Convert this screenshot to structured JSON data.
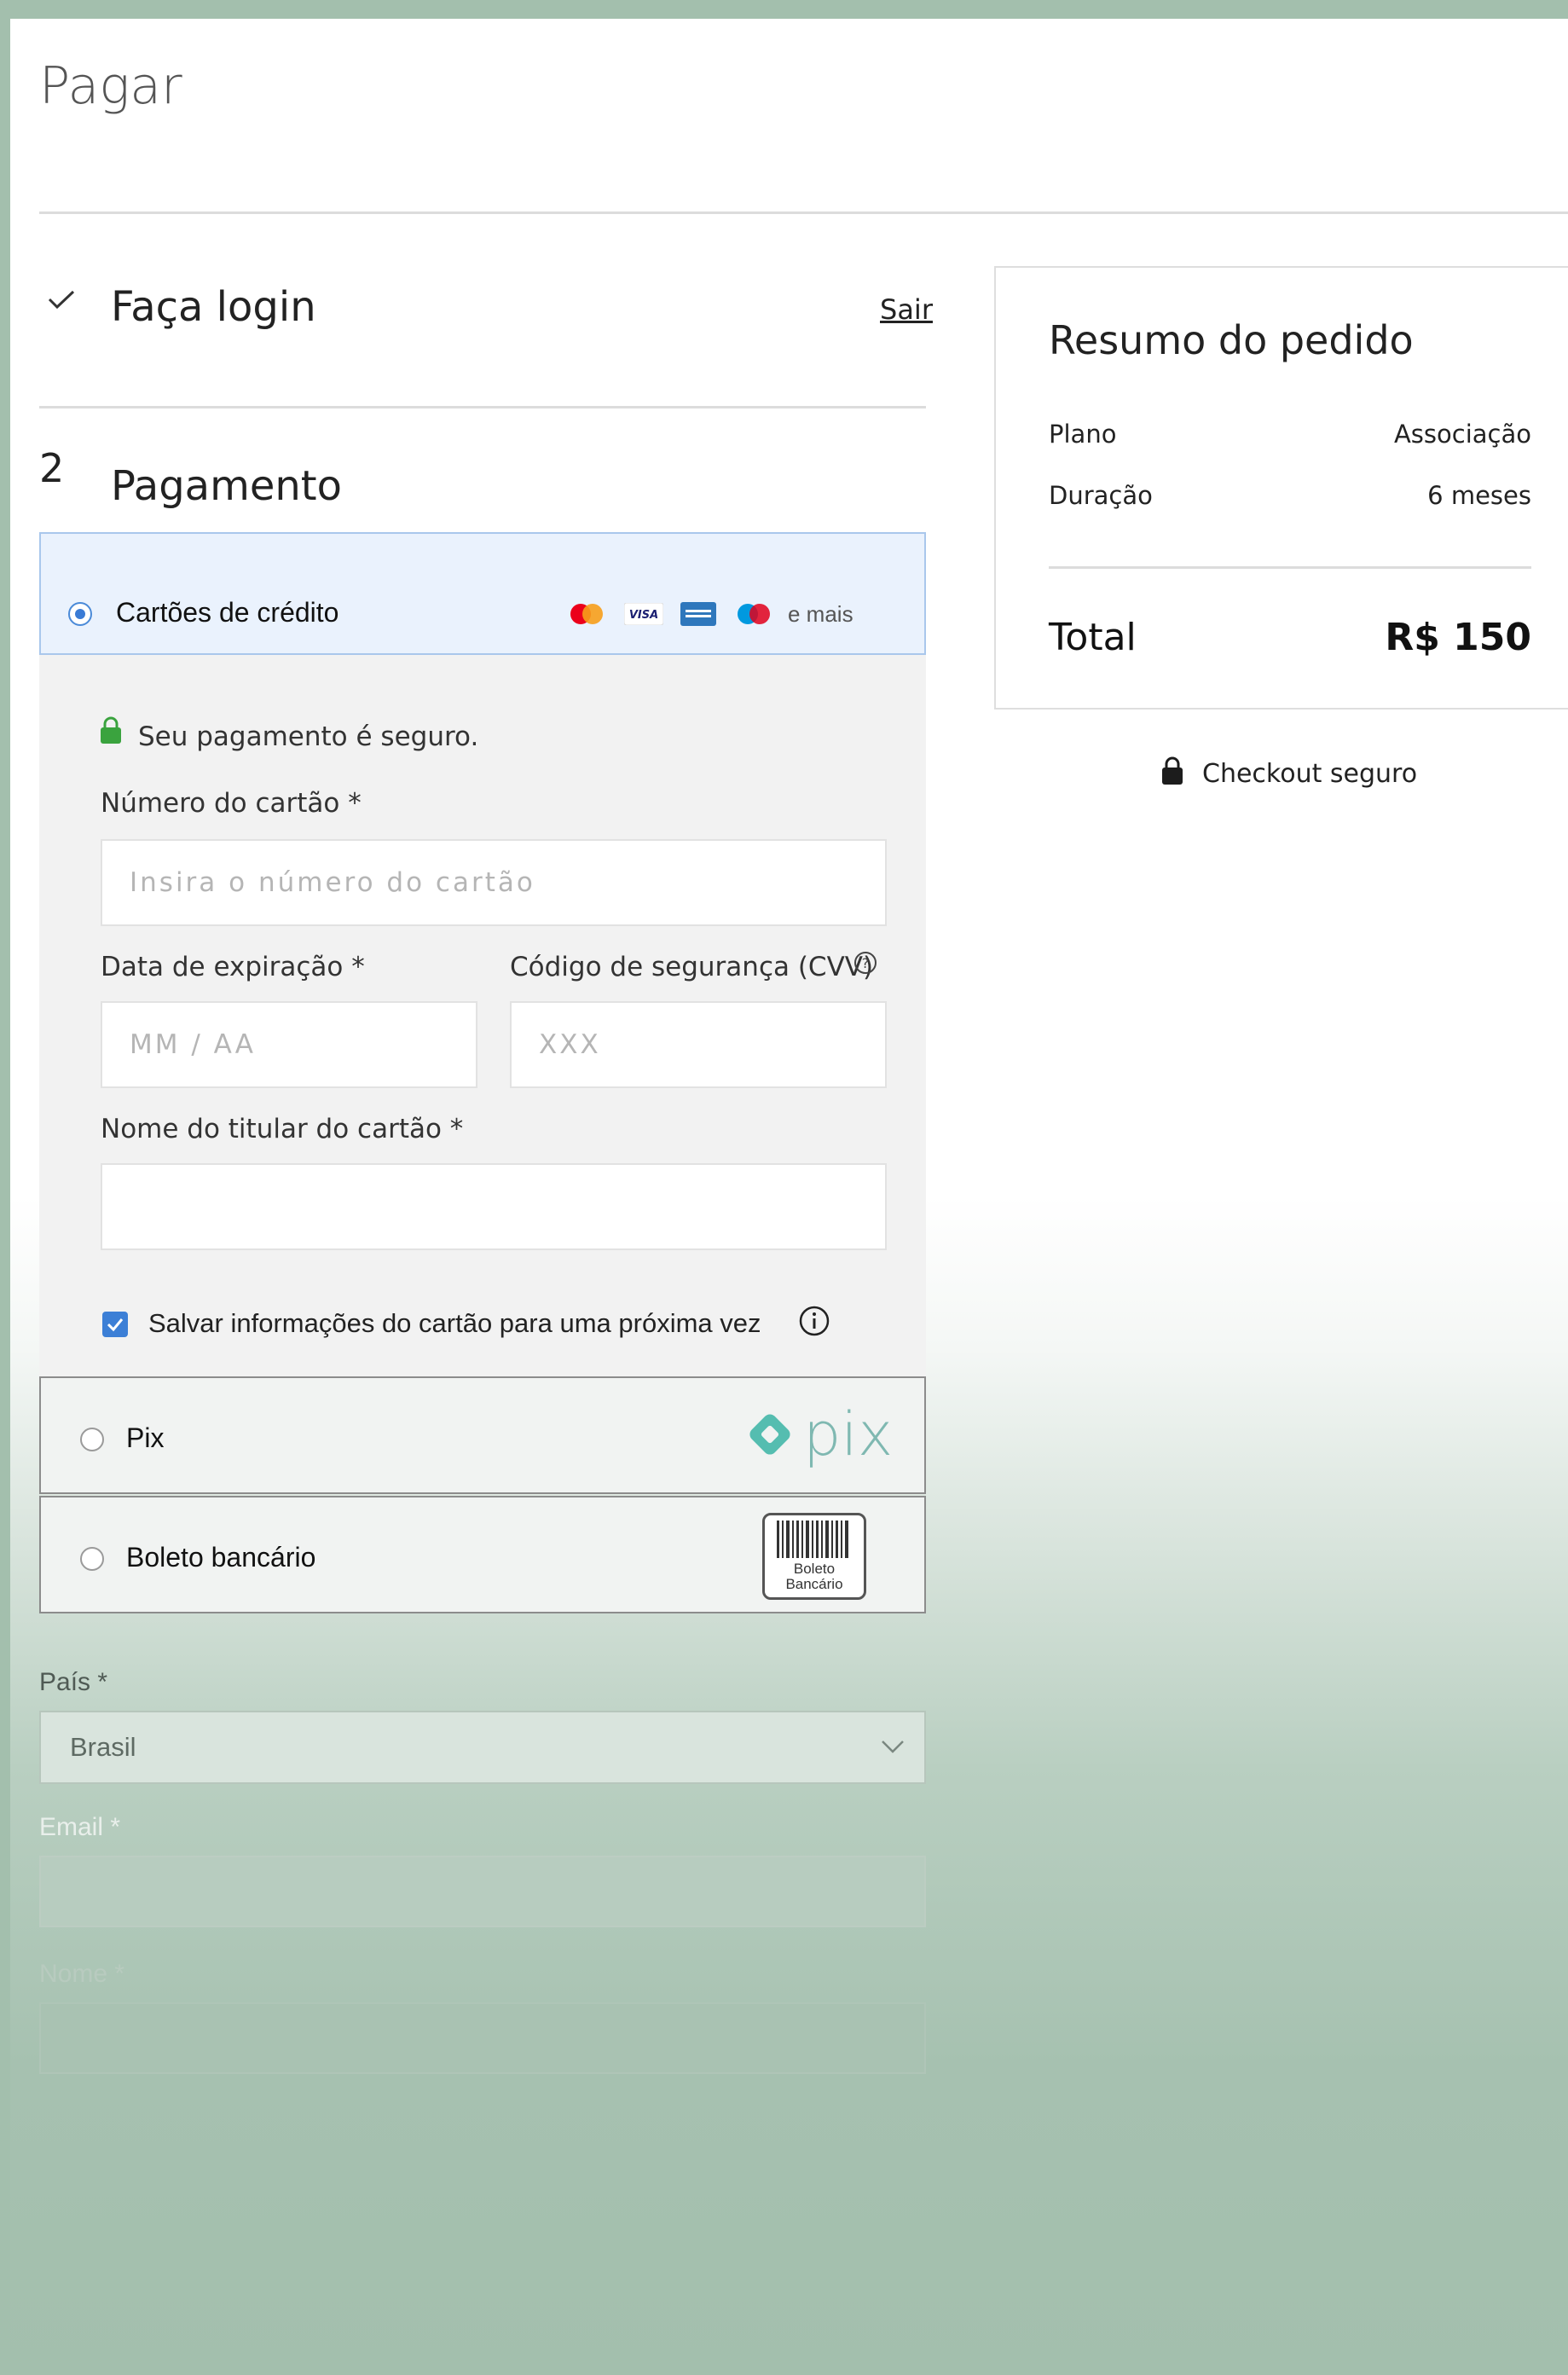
{
  "page": {
    "title": "Pagar"
  },
  "steps": {
    "login": {
      "title": "Faça login",
      "action": "Sair"
    },
    "payment": {
      "number": "2",
      "title": "Pagamento"
    }
  },
  "payment_options": {
    "credit_card": {
      "label": "Cartões de crédito",
      "brands": [
        "mastercard",
        "VISA",
        "amex",
        "maestro"
      ],
      "more": "e mais",
      "secure_note": "Seu pagamento é seguro.",
      "card_number_label": "Número do cartão *",
      "card_number_placeholder": "Insira o número do cartão",
      "expiry_label": "Data de expiração *",
      "expiry_placeholder": "MM / AA",
      "cvv_label": "Código de segurança (CVV)",
      "cvv_placeholder": "XXX",
      "holder_label": "Nome do titular do cartão *",
      "holder_value": "",
      "save_label": "Salvar informações do cartão para uma próxima vez",
      "save_checked": true
    },
    "pix": {
      "label": "Pix",
      "logo_text": "pix"
    },
    "boleto": {
      "label": "Boleto bancário",
      "logo_line1": "Boleto",
      "logo_line2": "Bancário"
    }
  },
  "address": {
    "country_label": "País *",
    "country_value": "Brasil",
    "email_label": "Email *",
    "name_label": "Nome *"
  },
  "summary": {
    "title": "Resumo do pedido",
    "rows": [
      {
        "label": "Plano",
        "value": "Associação"
      },
      {
        "label": "Duração",
        "value": "6 meses"
      }
    ],
    "total_label": "Total",
    "total_value": "R$ 150",
    "secure_checkout": "Checkout seguro"
  },
  "colors": {
    "background": "#a3bfad",
    "accent_blue": "#3c7fd6",
    "lock_green": "#3aa33e",
    "pix_teal": "#55bdb0"
  }
}
